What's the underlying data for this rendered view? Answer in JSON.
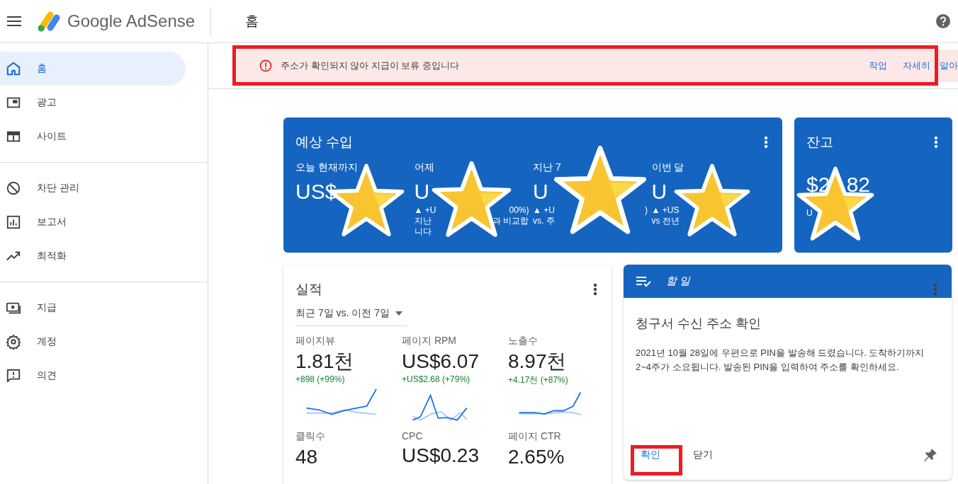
{
  "app_bar": {
    "product": "Google AdSense",
    "page_title": "홈"
  },
  "sidebar": {
    "groups": [
      {
        "items": [
          {
            "label": "홈",
            "selected": true
          },
          {
            "label": "광고",
            "selected": false
          },
          {
            "label": "사이트",
            "selected": false
          }
        ]
      },
      {
        "items": [
          {
            "label": "차단 관리",
            "selected": false
          },
          {
            "label": "보고서",
            "selected": false
          },
          {
            "label": "최적화",
            "selected": false
          }
        ]
      },
      {
        "items": [
          {
            "label": "지급",
            "selected": false
          },
          {
            "label": "계정",
            "selected": false
          },
          {
            "label": "의견",
            "selected": false
          }
        ]
      }
    ]
  },
  "alert": {
    "message": "주소가 확인되지 않아 지급이 보류 중입니다",
    "actions": [
      "작업",
      "자세히 알아"
    ]
  },
  "earnings": {
    "title": "예상 수입",
    "columns": [
      {
        "label": "오늘 현재까지",
        "value": "US$"
      },
      {
        "label": "어제",
        "value": "U",
        "lines": [
          {
            "head": "▲ +U",
            "tail": "00%)"
          },
          {
            "head": "지난",
            "tail": "과 비교합"
          },
          {
            "head": "니다"
          }
        ]
      },
      {
        "label": "지난 7",
        "value": "U",
        "lines": [
          {
            "head": "▲ +U",
            "tail": ")"
          },
          {
            "head": "vs. 주"
          }
        ]
      },
      {
        "label": "이번 달",
        "value": "U",
        "lines": [
          {
            "head": "▲ +US"
          },
          {
            "head": "vs 전년"
          }
        ]
      }
    ]
  },
  "balance": {
    "title": "잔고",
    "value": "$2",
    "value_tail": "82",
    "lines": [
      "U"
    ]
  },
  "performance": {
    "title": "실적",
    "range": "최근 7일 vs. 이전 7일",
    "metrics": [
      {
        "label": "페이지뷰",
        "value": "1.81천",
        "change": "+898 (+99%)"
      },
      {
        "label": "페이지 RPM",
        "value": "US$6.07",
        "change": "+US$2.68 (+79%)"
      },
      {
        "label": "노출수",
        "value": "8.97천",
        "change": "+4.17천 (+87%)"
      },
      {
        "label": "클릭수",
        "value": "48"
      },
      {
        "label": "CPC",
        "value": "US$0.23"
      },
      {
        "label": "페이지 CTR",
        "value": "2.65%"
      }
    ]
  },
  "todo": {
    "header": "할 일",
    "title": "청구서 수신 주소 확인",
    "body": "2021년 10월 28일에 우편으로 PIN을 발송해 드렸습니다. 도착하기까지 2~4주가 소요됩니다. 발송된 PIN을 입력하여 주소를 확인하세요.",
    "actions": [
      "확인",
      "닫기"
    ]
  }
}
